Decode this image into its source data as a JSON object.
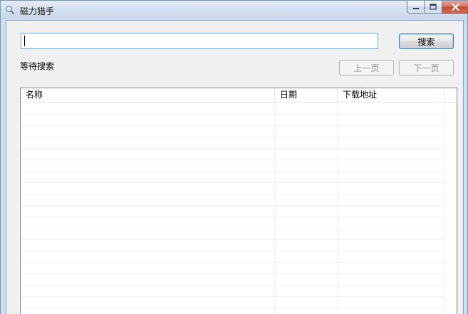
{
  "window": {
    "title": "磁力猎手",
    "icon": "magnifier-icon",
    "controls": {
      "minimize": "minimize-icon",
      "maximize": "maximize-icon",
      "close": "close-icon"
    }
  },
  "search": {
    "value": "",
    "placeholder": "",
    "button_label": "搜索"
  },
  "status_text": "等待搜索",
  "pagination": {
    "prev_label": "上一页",
    "next_label": "下一页"
  },
  "table": {
    "columns": [
      "名称",
      "日期",
      "下载地址"
    ],
    "rows": []
  },
  "colors": {
    "input_border": "#7aa7d2",
    "focus_button_border": "#3c7fb1",
    "close_button": "#c44a30"
  }
}
